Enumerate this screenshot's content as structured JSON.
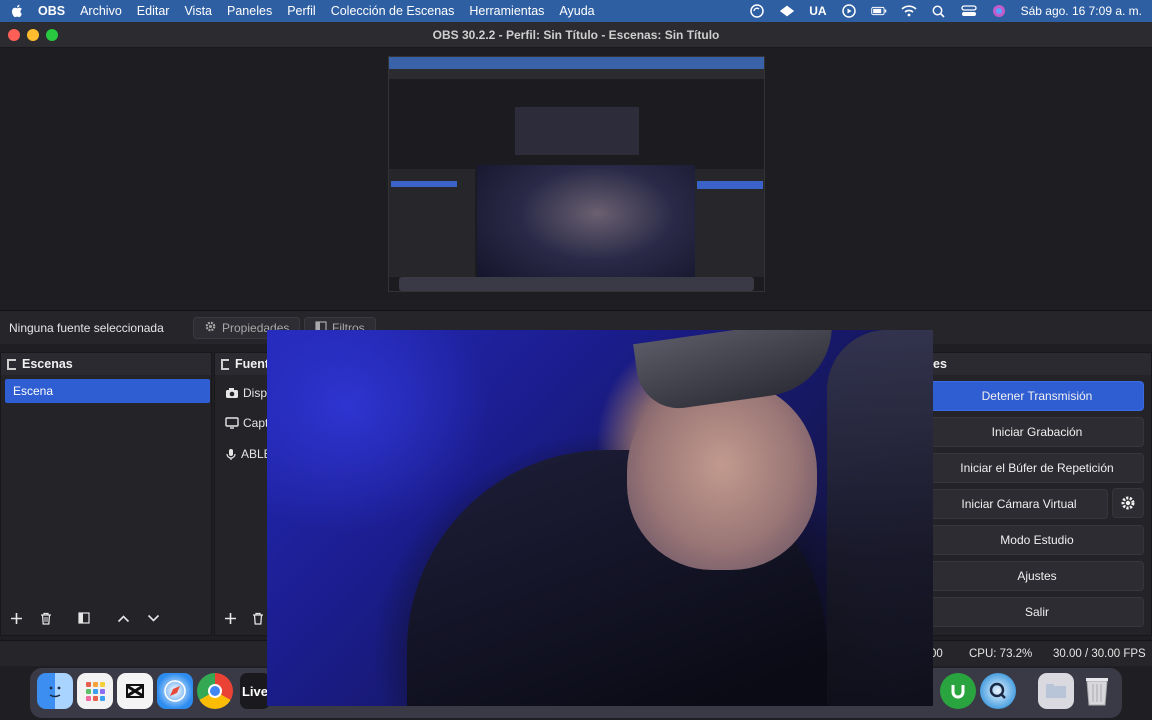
{
  "menubar": {
    "app_name": "OBS",
    "items": [
      "Archivo",
      "Editar",
      "Vista",
      "Paneles",
      "Perfil",
      "Colección de Escenas",
      "Herramientas",
      "Ayuda"
    ],
    "input_source": "UA",
    "clock": "Sáb ago. 16  7:09 a. m."
  },
  "window": {
    "title": "OBS 30.2.2 - Perfil: Sin Título - Escenas: Sin Título"
  },
  "source_toolbar": {
    "no_selection": "Ninguna fuente seleccionada",
    "properties_label": "Propiedades",
    "filters_label": "Filtros"
  },
  "scenes": {
    "title": "Escenas",
    "items": [
      {
        "label": "Escena"
      }
    ]
  },
  "sources": {
    "title": "Fuent",
    "items": [
      {
        "label": "Dispo",
        "icon": "camera-icon"
      },
      {
        "label": "Capt",
        "icon": "monitor-icon"
      },
      {
        "label": "ABLE",
        "icon": "microphone-icon"
      }
    ]
  },
  "controls": {
    "title": "es",
    "stop_stream": "Detener Transmisión",
    "start_recording": "Iniciar Grabación",
    "start_replay_buffer": "Iniciar el Búfer de Repetición",
    "start_virtual_camera": "Iniciar Cámara Virtual",
    "studio_mode": "Modo Estudio",
    "settings": "Ajustes",
    "exit": "Salir"
  },
  "status": {
    "time_fragment": "00",
    "cpu": "CPU: 73.2%",
    "fps": "30.00 / 30.00 FPS"
  },
  "macdock": {
    "live_label": "Live"
  },
  "colors": {
    "accent": "#2f5dd2",
    "menubar": "#2f5fa3"
  }
}
